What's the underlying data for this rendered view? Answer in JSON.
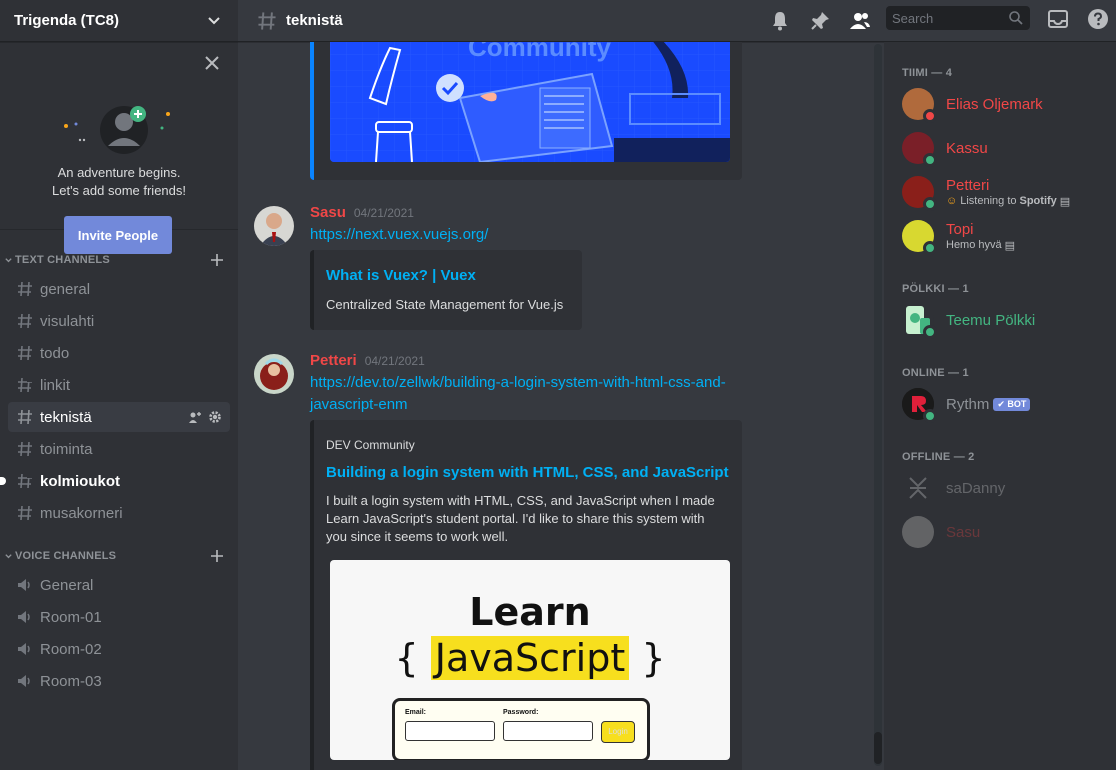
{
  "server": {
    "name": "Trigenda (TC8)"
  },
  "friends_card": {
    "line1": "An adventure begins.",
    "line2": "Let's add some friends!",
    "invite_label": "Invite People"
  },
  "categories": {
    "text": "TEXT CHANNELS",
    "voice": "VOICE CHANNELS"
  },
  "text_channels": [
    "general",
    "visulahti",
    "todo",
    "linkit",
    "teknistä",
    "toiminta",
    "kolmioukot",
    "musakorneri"
  ],
  "voice_channels": [
    "General",
    "Room-01",
    "Room-02",
    "Room-03"
  ],
  "active_channel": "teknistä",
  "search": {
    "placeholder": "Search"
  },
  "messages": [
    {
      "author": "Sasu",
      "timestamp": "04/21/2021",
      "link": "https://next.vuex.vuejs.org/",
      "embed": {
        "title": "What is Vuex? | Vuex",
        "description": "Centralized State Management for Vue.js"
      }
    },
    {
      "author": "Petteri",
      "timestamp": "04/21/2021",
      "link_line1": "https://dev.to/zellwk/building-a-login-system-with-html-css-and-",
      "link_line2": "javascript-enm",
      "embed": {
        "provider": "DEV Community",
        "title": "Building a login system with HTML, CSS, and JavaScript",
        "desc_line1": "I built a login system with HTML, CSS, and JavaScript when I made",
        "desc_line2": "Learn JavaScript's student portal. I'd like to share this system with",
        "desc_line3": "you since it seems to work well.",
        "image": {
          "title1": "Learn",
          "brace_open": "{",
          "title2": "JavaScript",
          "brace_close": "}",
          "email_label": "Email:",
          "password_label": "Password:",
          "login_label": "Login"
        }
      }
    }
  ],
  "community_image_text": "Community",
  "member_groups": {
    "tiimi": "TIIMI — 4",
    "polkki": "PÖLKKI — 1",
    "online": "ONLINE — 1",
    "offline": "OFFLINE — 2"
  },
  "members": {
    "elias": "Elias Oljemark",
    "kassu": "Kassu",
    "petteri": "Petteri",
    "petteri_activity_prefix": "Listening to",
    "petteri_activity_app": "Spotify",
    "topi": "Topi",
    "topi_activity": "Hemo hyvä",
    "teemu": "Teemu Pölkki",
    "rythm": "Rythm",
    "rythm_tag": "BOT",
    "sadanny": "saDanny",
    "sasu": "Sasu"
  },
  "colors": {
    "red_role": "#f04747",
    "green_role": "#43b581",
    "link": "#00b0f4",
    "blurple": "#7289da"
  }
}
